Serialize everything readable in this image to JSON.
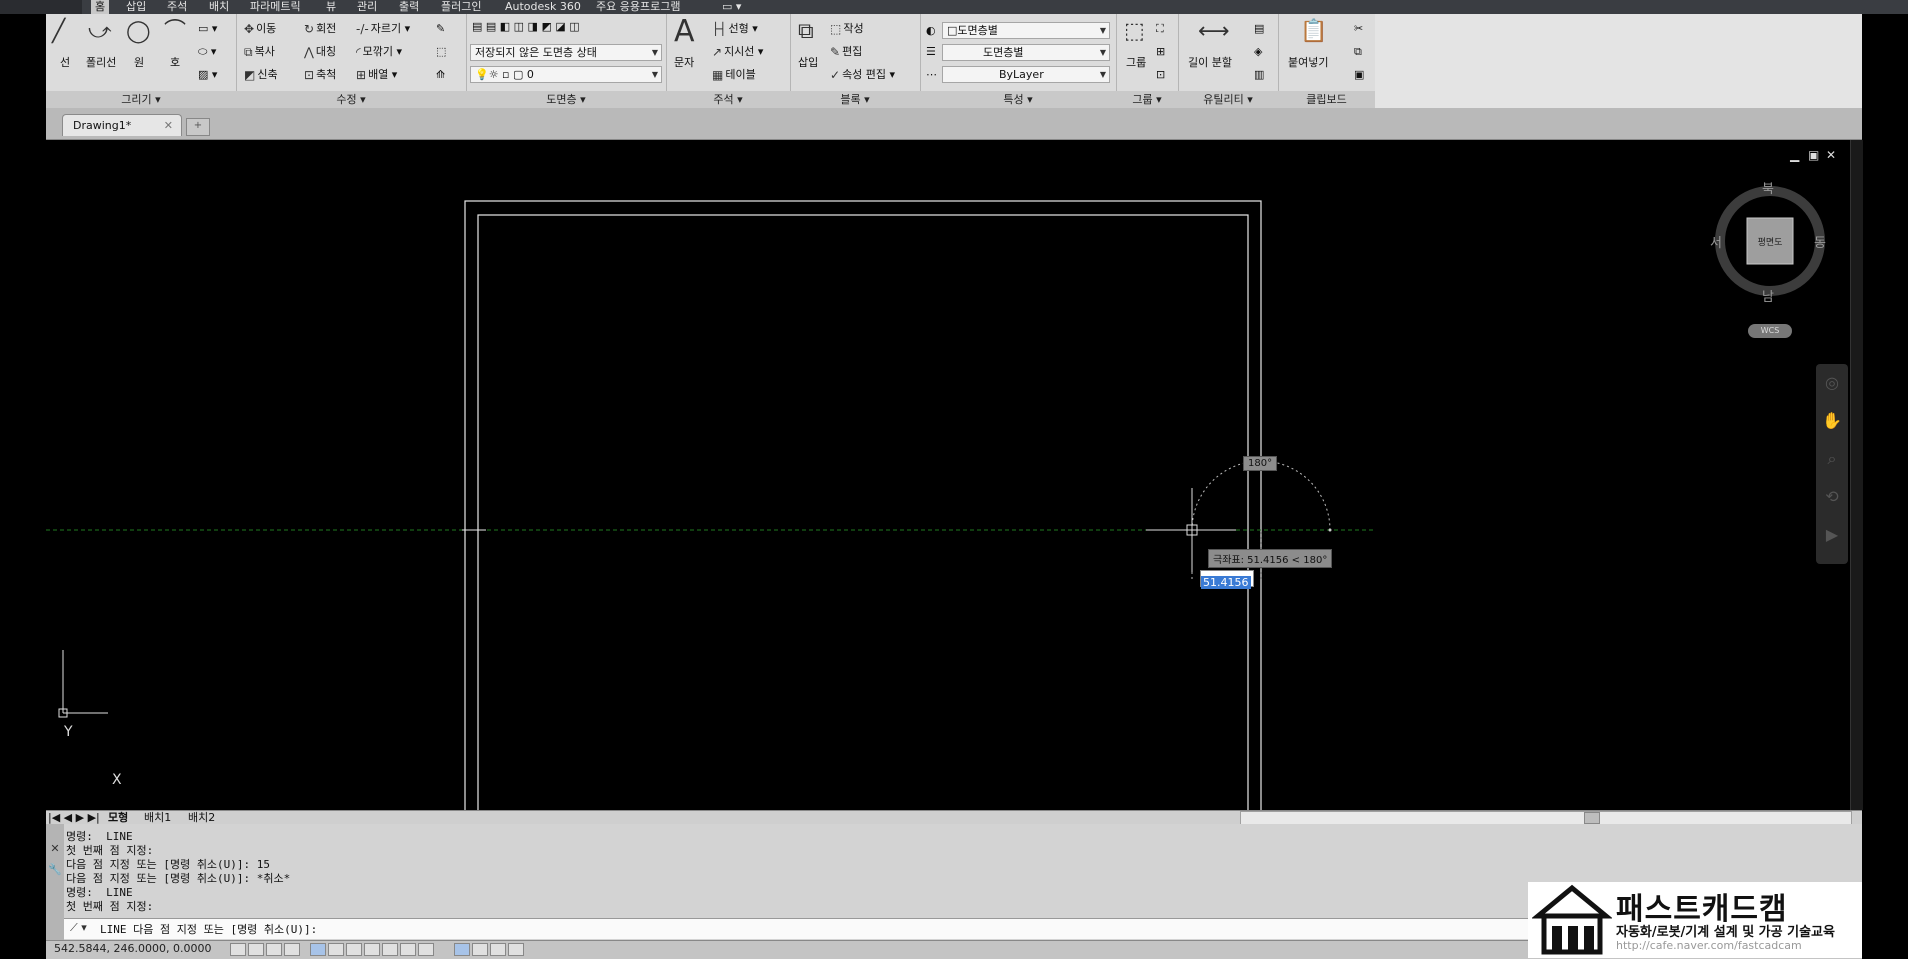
{
  "menu": {
    "tabs": [
      "홈",
      "삽입",
      "주석",
      "배치",
      "파라메트릭",
      "뷰",
      "관리",
      "출력",
      "플러그인",
      "Autodesk 360",
      "주요 응용프로그램"
    ],
    "active": "홈",
    "extra": "▭ ▾"
  },
  "ribbon": {
    "draw": {
      "title": "그리기 ▾",
      "line": "선",
      "polyline": "폴리선",
      "circle": "원",
      "arc": "호"
    },
    "modify": {
      "title": "수정 ▾",
      "move": "이동",
      "rotate": "회전",
      "trim": "자르기",
      "copy": "복사",
      "mirror": "대칭",
      "fillet": "모깎기",
      "stretch": "신축",
      "scale": "축척",
      "array": "배열"
    },
    "layers": {
      "title": "도면층 ▾",
      "state": "저장되지 않은 도면층 상태",
      "layer": "0"
    },
    "annotation": {
      "title": "주석 ▾",
      "text": "문자",
      "linear": "선형",
      "leader": "지시선",
      "table": "테이블"
    },
    "block": {
      "title": "블록 ▾",
      "insert": "삽입",
      "create": "작성",
      "edit": "편집",
      "attr_edit": "속성 편집"
    },
    "properties": {
      "title": "특성 ▾",
      "color": "도면층별",
      "lineweight": "도면층별",
      "linetype": "ByLayer"
    },
    "groups": {
      "title": "그룹 ▾",
      "group": "그룹"
    },
    "utilities": {
      "title": "유틸리티 ▾",
      "measure": "길이 분할"
    },
    "clipboard": {
      "title": "클립보드",
      "paste": "붙여넣기"
    }
  },
  "doc_tab": {
    "name": "Drawing1*",
    "close": "✕"
  },
  "viewcube": {
    "north": "북",
    "south": "남",
    "east": "동",
    "west": "서",
    "face": "평면도",
    "wcs": "WCS"
  },
  "window_controls": {
    "minimize": "▁",
    "restore": "▣",
    "close": "✕"
  },
  "ucs": {
    "y": "Y",
    "x": "X"
  },
  "dynamic_input": {
    "angle": "180°",
    "polar": "극좌표: 51.4156 < 180°",
    "value": "51.4156"
  },
  "layout_tabs": [
    "모형",
    "배치1",
    "배치2"
  ],
  "command_history": [
    "명령:  LINE",
    "첫 번째 점 지정:",
    "다음 점 지정 또는 [명령 취소(U)]: 15",
    "다음 점 지정 또는 [명령 취소(U)]: *취소*",
    "명령:  LINE",
    "첫 번째 점 지정:"
  ],
  "command_prompt": "LINE 다음 점 지정 또는 [명령 취소(U)]:",
  "status": {
    "coords": "542.5844, 246.0000, 0.0000"
  },
  "logo": {
    "title": "패스트캐드캠",
    "subtitle": "자동화/로봇/기계 설계 및 가공 기술교육",
    "url": "http://cafe.naver.com/fastcadcam"
  },
  "colors": {
    "background": "#000000",
    "ribbon": "#dcdcdc",
    "highlight": "#3a7bd5"
  }
}
